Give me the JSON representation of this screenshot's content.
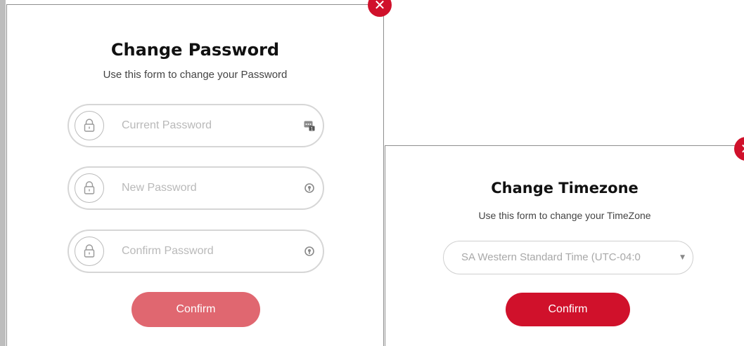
{
  "password_modal": {
    "title": "Change Password",
    "subtitle": "Use this form to change your Password",
    "fields": [
      {
        "placeholder": "Current Password",
        "value": "",
        "trailing_icon": "password-manager-icon"
      },
      {
        "placeholder": "New Password",
        "value": "",
        "trailing_icon": "password-generator-icon"
      },
      {
        "placeholder": "Confirm Password",
        "value": "",
        "trailing_icon": "password-generator-icon"
      }
    ],
    "confirm_label": "Confirm",
    "confirm_color": "#e06770",
    "close_icon": "close-icon"
  },
  "timezone_modal": {
    "title": "Change Timezone",
    "subtitle": "Use this form to change your TimeZone",
    "selected_timezone": "SA Western Standard Time (UTC-04:0",
    "confirm_label": "Confirm",
    "confirm_color": "#d0112b",
    "close_icon": "close-icon"
  },
  "colors": {
    "accent": "#d0112b",
    "disabled_accent": "#e06770",
    "field_border": "#d6d6d6",
    "placeholder": "#b9b9b9"
  }
}
